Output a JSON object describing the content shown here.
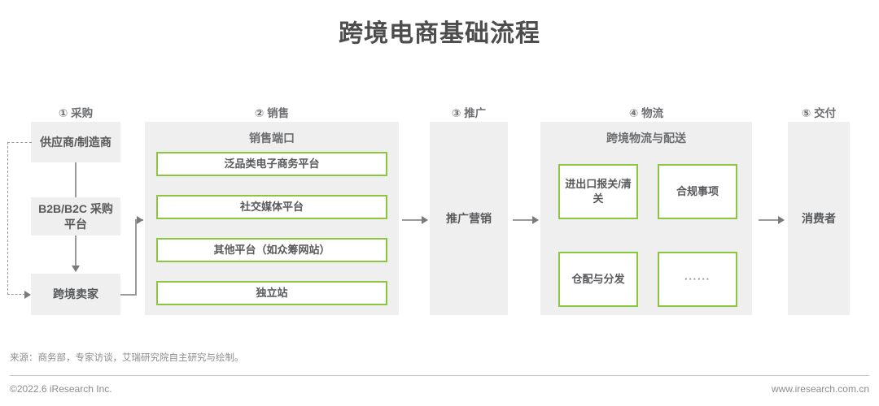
{
  "title": "跨境电商基础流程",
  "columns": [
    {
      "header": "① 采购",
      "boxes": [
        {
          "label": "供应商/制造商"
        },
        {
          "label": "B2B/B2C 采购平台"
        },
        {
          "label": "跨境卖家"
        }
      ]
    },
    {
      "header": "② 销售",
      "panel_title": "销售端口",
      "items": [
        {
          "label": "泛品类电子商务平台"
        },
        {
          "label": "社交媒体平台"
        },
        {
          "label": "其他平台（如众筹网站）"
        },
        {
          "label": "独立站"
        }
      ]
    },
    {
      "header": "③ 推广",
      "boxes": [
        {
          "label": "推广营销"
        }
      ]
    },
    {
      "header": "④ 物流",
      "panel_title": "跨境物流与配送",
      "items": [
        {
          "label": "进出口报关/清关"
        },
        {
          "label": "合规事项"
        },
        {
          "label": "仓配与分发"
        },
        {
          "label": "······"
        }
      ]
    },
    {
      "header": "⑤ 交付",
      "boxes": [
        {
          "label": "消费者"
        }
      ]
    }
  ],
  "footer": {
    "source": "来源：商务部，专家访谈，艾瑞研究院自主研究与绘制。",
    "copyright": "©2022.6 iResearch Inc.",
    "website": "www.iresearch.com.cn"
  },
  "colors": {
    "accent_green": "#8cc63f",
    "panel_gray": "#efefef",
    "text_gray": "#58595b",
    "line_gray": "#9a9a9a"
  }
}
